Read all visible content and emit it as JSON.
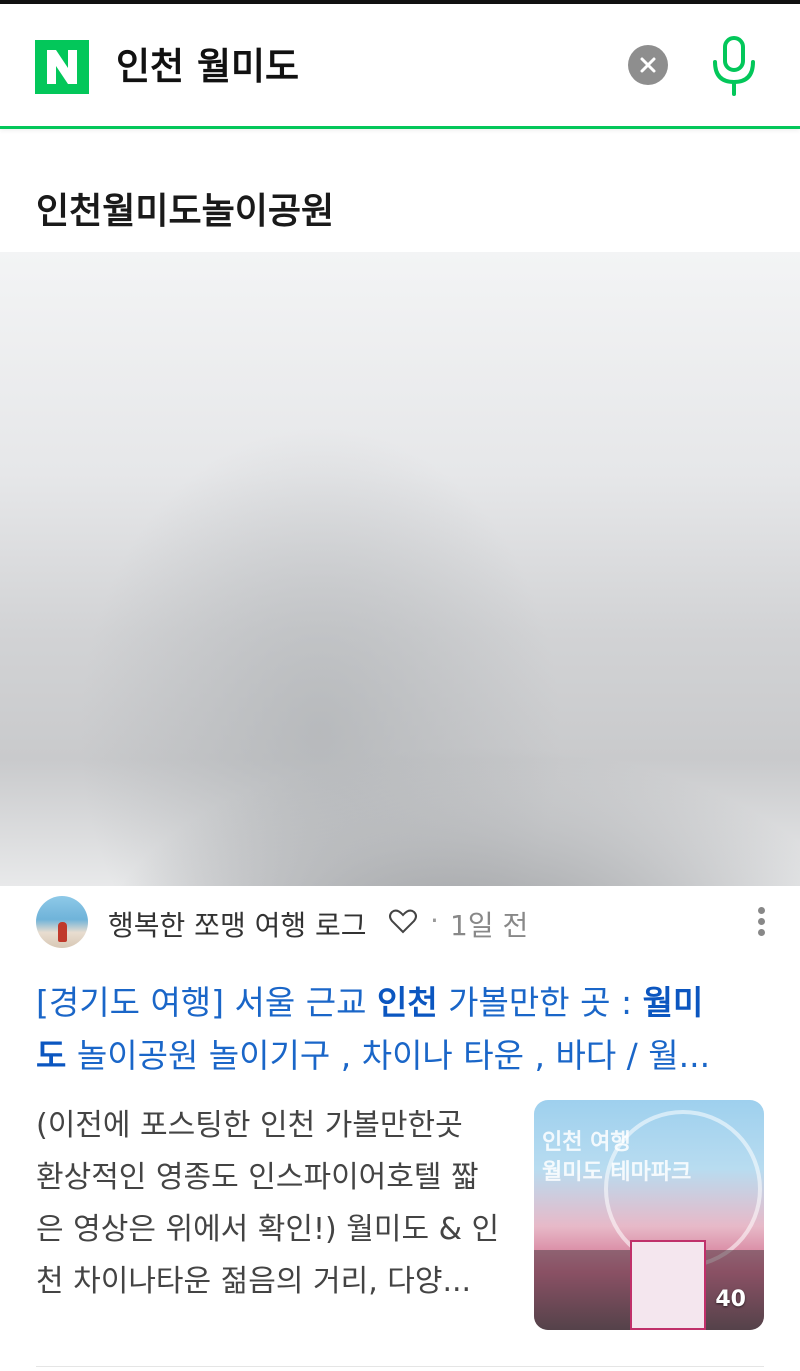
{
  "search": {
    "query": "인천 월미도",
    "logo_letter": "N",
    "brand_color": "#03c75a"
  },
  "icons": {
    "clear": "close-icon",
    "mic": "mic-icon",
    "heart": "heart-outline-icon",
    "more": "more-vertical-icon"
  },
  "result": {
    "card_title": "인천월미도놀이공원",
    "author": "행복한 쪼맹 여행 로그",
    "separator": "·",
    "time": "1일 전",
    "headline_line1_a": "[경기도 여행] 서울 근교 ",
    "headline_line1_b": "인천",
    "headline_line1_c": " 가볼만한 곳 : ",
    "headline_line1_d": "월미",
    "headline_line2_a": "도",
    "headline_line2_b": " 놀이공원 놀이기구 , 차이나 타운 , 바다 / 월...",
    "snippet_line1": "(이전에 포스팅한 인천 가볼만한곳",
    "snippet_line2": "환상적인 영종도 인스파이어호텔 짧",
    "snippet_line3": "은 영상은 위에서 확인!) 월미도 & 인",
    "snippet_line4": "천 차이나타운 젊음의 거리, 다양...",
    "thumb_text_line1": "인천 여행",
    "thumb_text_line2": "월미도 테마파크",
    "thumb_count": "40"
  }
}
